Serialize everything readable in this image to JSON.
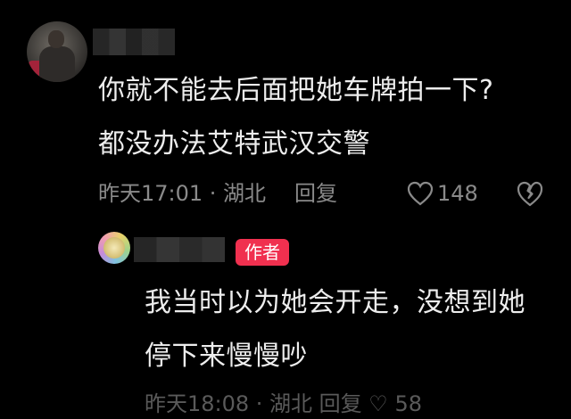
{
  "main_comment": {
    "lines": [
      "你就不能去后面把她车牌拍一下?",
      "都没办法艾特武汉交警"
    ],
    "time_location": "昨天17:01 · 湖北",
    "reply_label": "回复",
    "like_count": "148"
  },
  "reply_comment": {
    "author_badge": "作者",
    "lines": [
      "我当时以为她会开走，没想到她",
      "停下来慢慢吵"
    ],
    "meta_partial": "昨天18:08 · 湖北  回复  ♡ 58"
  },
  "icons": {
    "like": "heart-outline-icon",
    "dislike": "broken-heart-icon"
  },
  "colors": {
    "background": "#000000",
    "text": "#ededed",
    "meta": "#8a8a8a",
    "badge": "#f0304f"
  }
}
